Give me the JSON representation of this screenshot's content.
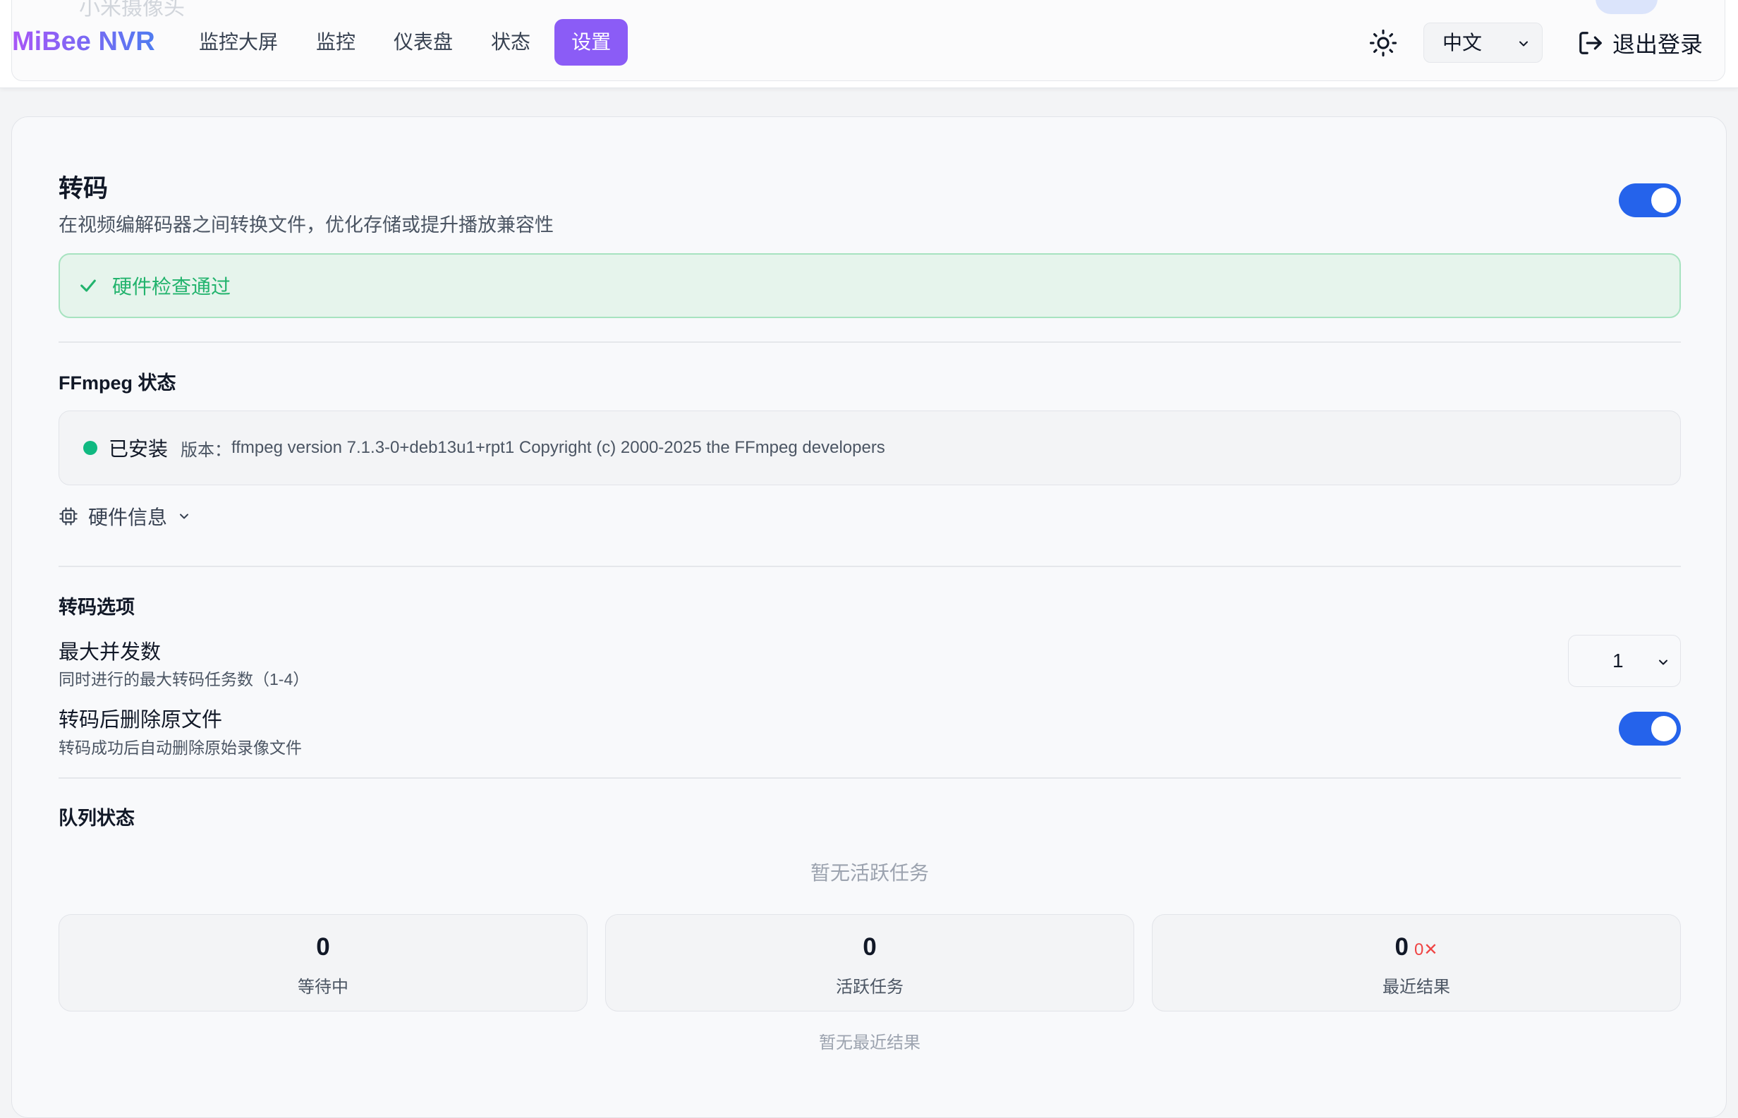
{
  "behind": {
    "text": "小米摄像头"
  },
  "header": {
    "logo": "MiBee NVR",
    "nav": [
      {
        "label": "监控大屏"
      },
      {
        "label": "监控"
      },
      {
        "label": "仪表盘"
      },
      {
        "label": "状态"
      },
      {
        "label": "设置",
        "active": true
      }
    ],
    "theme_icon": "sun-icon",
    "language": "中文",
    "logout_label": "退出登录"
  },
  "transcode": {
    "title": "转码",
    "description": "在视频编解码器之间转换文件，优化存储或提升播放兼容性",
    "enabled": true,
    "hardware_check": "硬件检查通过",
    "ffmpeg_section_title": "FFmpeg 状态",
    "ffmpeg_status": "已安装",
    "version_label": "版本：",
    "version": "ffmpeg version 7.1.3-0+deb13u1+rpt1 Copyright (c) 2000-2025 the FFmpeg developers",
    "hardware_info_label": "硬件信息",
    "options_title": "转码选项",
    "max_concurrent_label": "最大并发数",
    "max_concurrent_desc": "同时进行的最大转码任务数（1-4）",
    "max_concurrent_value": "1",
    "delete_original_label": "转码后删除原文件",
    "delete_original_desc": "转码成功后自动删除原始录像文件",
    "delete_original_enabled": true,
    "queue_title": "队列状态",
    "no_active_tasks": "暂无活跃任务",
    "stats": [
      {
        "value": "0",
        "label": "等待中"
      },
      {
        "value": "0",
        "label": "活跃任务"
      },
      {
        "value": "0",
        "fail": "0✕",
        "label": "最近结果"
      }
    ],
    "no_recent_results": "暂无最近结果"
  },
  "colors": {
    "accent": "#8b5cf6",
    "toggle_on": "#2563eb",
    "success": "#22b36d",
    "installed_dot": "#10b981",
    "error": "#ef4444"
  }
}
